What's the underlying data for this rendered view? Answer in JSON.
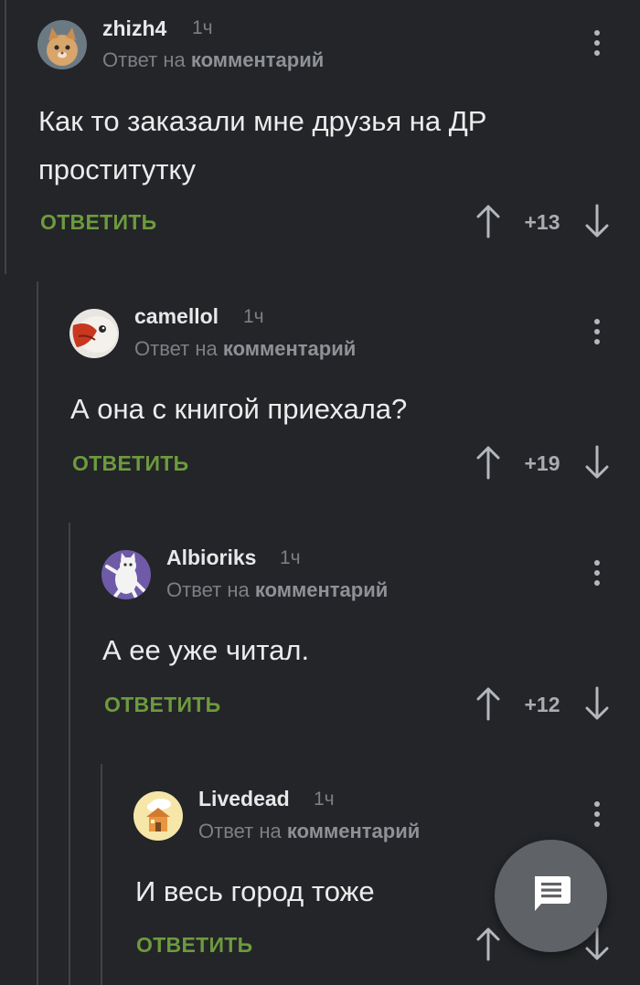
{
  "comments": [
    {
      "username": "zhizh4",
      "time": "1ч",
      "reply_prefix": "Ответ на",
      "reply_link": "комментарий",
      "text": "Как то заказали мне друзья на ДР проститутку",
      "reply_label": "ОТВЕТИТЬ",
      "rating": "+13",
      "avatar_icon": "cat-avatar-icon"
    },
    {
      "username": "camellol",
      "time": "1ч",
      "reply_prefix": "Ответ на",
      "reply_link": "комментарий",
      "text": "А она с книгой приехала?",
      "reply_label": "ОТВЕТИТЬ",
      "rating": "+19",
      "avatar_icon": "bird-avatar-icon"
    },
    {
      "username": "Albioriks",
      "time": "1ч",
      "reply_prefix": "Ответ на",
      "reply_link": "комментарий",
      "text": "А ее уже читал.",
      "reply_label": "ОТВЕТИТЬ",
      "rating": "+12",
      "avatar_icon": "cartoon-cat-avatar-icon"
    },
    {
      "username": "Livedead",
      "time": "1ч",
      "reply_prefix": "Ответ на",
      "reply_link": "комментарий",
      "text": "И весь город тоже",
      "reply_label": "ОТВЕТИТЬ",
      "rating": "",
      "avatar_icon": "house-avatar-icon"
    }
  ],
  "fab": {
    "icon": "comment-icon"
  },
  "colors": {
    "background": "#232528",
    "accent_green": "#6d9a3e",
    "muted": "#7c7f84",
    "fab": "#5f6267"
  }
}
